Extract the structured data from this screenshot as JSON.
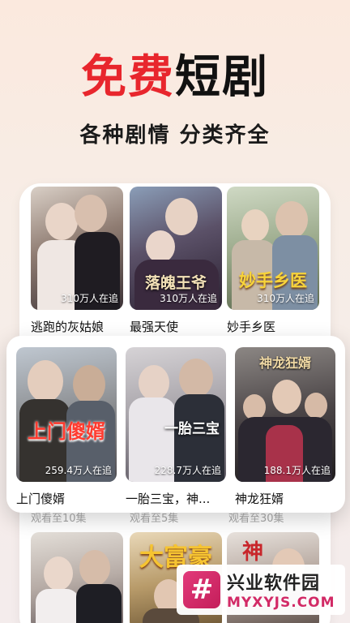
{
  "hero": {
    "title_red": "免费",
    "title_black": "短剧",
    "subtitle": "各种剧情 分类齐全"
  },
  "row1": [
    {
      "title": "逃跑的灰姑娘",
      "views": "310万人在追",
      "poster_text": ""
    },
    {
      "title": "最强天使",
      "views": "310万人在追",
      "poster_text": "落魄王爷"
    },
    {
      "title": "妙手乡医",
      "views": "310万人在追",
      "poster_text": "妙手乡医"
    }
  ],
  "row2": [
    {
      "title": "上门傻婿",
      "views": "259.4万人在追",
      "poster_text": "上门傻婿"
    },
    {
      "title": "一胎三宝，神...",
      "views": "228.7万人在追",
      "poster_text": "一胎三宝"
    },
    {
      "title": "神龙狂婿",
      "views": "188.1万人在追",
      "poster_text": "神龙狂婿"
    }
  ],
  "row2_sub": [
    "观看至10集",
    "观看至5集",
    "观看至30集"
  ],
  "row3": [
    {
      "poster_text": ""
    },
    {
      "poster_text": "大富豪"
    },
    {
      "poster_text": "神"
    }
  ],
  "watermark": {
    "name": "兴业软件园",
    "url": "MYXYJS.COM",
    "logo": "#"
  }
}
